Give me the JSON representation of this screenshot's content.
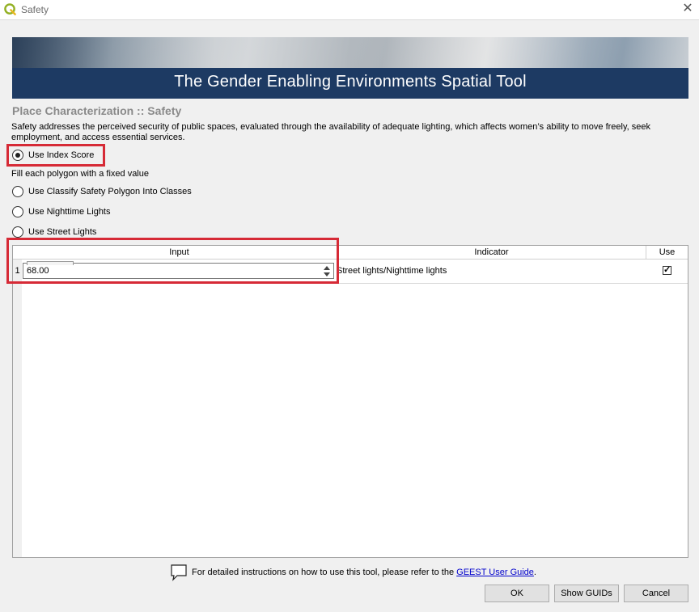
{
  "window": {
    "title": "Safety",
    "close_glyph": "✕",
    "icon": "qgis-icon"
  },
  "banner": {
    "title": "The Gender Enabling Environments Spatial Tool"
  },
  "page": {
    "heading": "Place Characterization :: Safety",
    "description": "Safety addresses the perceived security of public spaces, evaluated through the availability of adequate lighting, which affects women’s ability to move freely, seek employment, and access essential services."
  },
  "options": {
    "index_score": {
      "label": "Use Index Score",
      "selected": true
    },
    "index_score_hint": "Fill each polygon with a fixed value",
    "classify": {
      "label": "Use Classify Safety Polygon Into Classes",
      "selected": false
    },
    "nighttime": {
      "label": "Use Nighttime Lights",
      "selected": false
    },
    "street": {
      "label": "Use Street Lights",
      "selected": false
    }
  },
  "table": {
    "columns": [
      "Input",
      "Indicator",
      "Use"
    ],
    "rows": [
      {
        "row_number": "1",
        "input": "68.00",
        "indicator": "Street lights/Nighttime lights",
        "use_checked": true,
        "check_glyph": "✓"
      }
    ]
  },
  "footer": {
    "help_prefix": "For detailed instructions on how to use this tool, please refer to the ",
    "help_link": "GEEST User Guide",
    "help_suffix": ".",
    "ok_label": "OK",
    "guids_label": "Show GUIDs",
    "cancel_label": "Cancel"
  },
  "colors": {
    "highlight": "#d62a36",
    "banner_bar": "#1d3a63",
    "link": "#0000cc"
  }
}
